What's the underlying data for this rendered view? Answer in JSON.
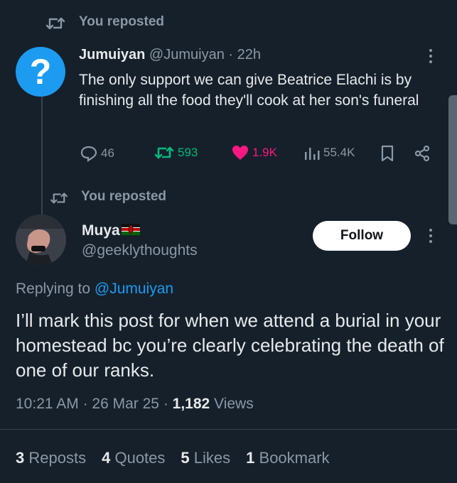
{
  "repost1": {
    "label": "You reposted"
  },
  "tweet1": {
    "name": "Jumuiyan",
    "handle": "@Jumuiyan",
    "time": "22h",
    "text": "The only support we can give Beatrice Elachi is by finishing all the food they'll cook at her son's funeral",
    "replies": "46",
    "reposts": "593",
    "likes": "1.9K",
    "views": "55.4K"
  },
  "repost2": {
    "label": "You reposted"
  },
  "tweet2": {
    "name": "Muya",
    "handle": "@geeklythoughts",
    "follow_label": "Follow",
    "replying_prefix": "Replying to",
    "replying_handle": "@Jumuiyan",
    "text": "I’ll mark this post for when we attend a burial in your homestead bc you’re clearly celebrating the death of one of our ranks.",
    "time": "10:21 AM",
    "date": "26 Mar 25",
    "views_count": "1,182",
    "views_label": "Views"
  },
  "stats": [
    {
      "count": "3",
      "label": "Reposts"
    },
    {
      "count": "4",
      "label": "Quotes"
    },
    {
      "count": "5",
      "label": "Likes"
    },
    {
      "count": "1",
      "label": "Bookmark"
    }
  ],
  "colors": {
    "background": "#15202b",
    "accent": "#1d9bf0",
    "repost": "#00ba7c",
    "like": "#f91880",
    "muted": "#8b98a5"
  },
  "icons": [
    "repost-icon",
    "question-avatar",
    "reply-icon",
    "heart-icon",
    "views-icon",
    "bookmark-icon",
    "share-icon",
    "more-icon",
    "kenya-flag-icon"
  ]
}
